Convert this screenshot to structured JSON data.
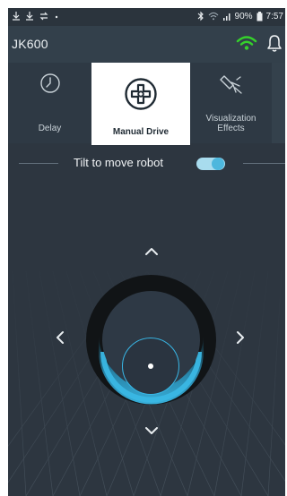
{
  "status_bar": {
    "battery_percent": "90%",
    "time": "7:57",
    "icons": [
      "download-icon",
      "download-icon",
      "sync-icon",
      "dot-icon",
      "bluetooth-icon",
      "wifi-icon",
      "signal-icon",
      "battery-icon"
    ]
  },
  "app_bar": {
    "title": "JK600",
    "icons": [
      "wifi-connected-icon",
      "bell-icon"
    ],
    "accent_color": "#35d12b"
  },
  "tabs": [
    {
      "label": "Delay",
      "icon": "timer-icon",
      "selected": false
    },
    {
      "label": "Manual Drive",
      "icon": "gamepad-icon",
      "selected": true
    },
    {
      "label": "Visualization\nEffects",
      "icon": "sparkle-icon",
      "selected": false
    }
  ],
  "tilt_control": {
    "label": "Tilt to move robot",
    "enabled": true
  },
  "joystick": {
    "directions": [
      "up",
      "left",
      "right",
      "down"
    ],
    "accent_color": "#3ab7e4"
  }
}
